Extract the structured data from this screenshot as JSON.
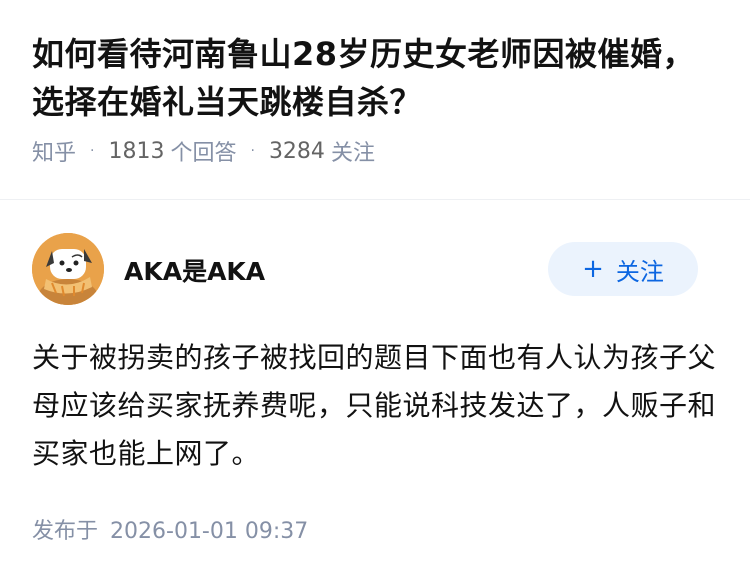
{
  "question": {
    "title": "如何看待河南鲁山28岁历史女老师因被催婚，选择在婚礼当天跳楼自杀？",
    "source": "知乎",
    "answer_count": "1813",
    "answer_label": "个回答",
    "follower_count": "3284",
    "follower_label": "关注"
  },
  "answer": {
    "author_name": "AKA是AKA",
    "follow_button": {
      "plus": "+",
      "label": "关注"
    },
    "content": "关于被拐卖的孩子被找回的题目下面也有人认为孩子父母应该给买家抚养费呢，只能说科技发达了，人贩子和买家也能上网了。",
    "publish_label": "发布于",
    "publish_time": "2026-01-01 09:37"
  },
  "colors": {
    "accent": "#0c66e1",
    "follow_bg": "#ebf3fd",
    "meta": "#8590a6",
    "avatar_bg": "#e9a24a"
  },
  "icons": {
    "avatar": "cartoon-dog-with-scarf"
  }
}
